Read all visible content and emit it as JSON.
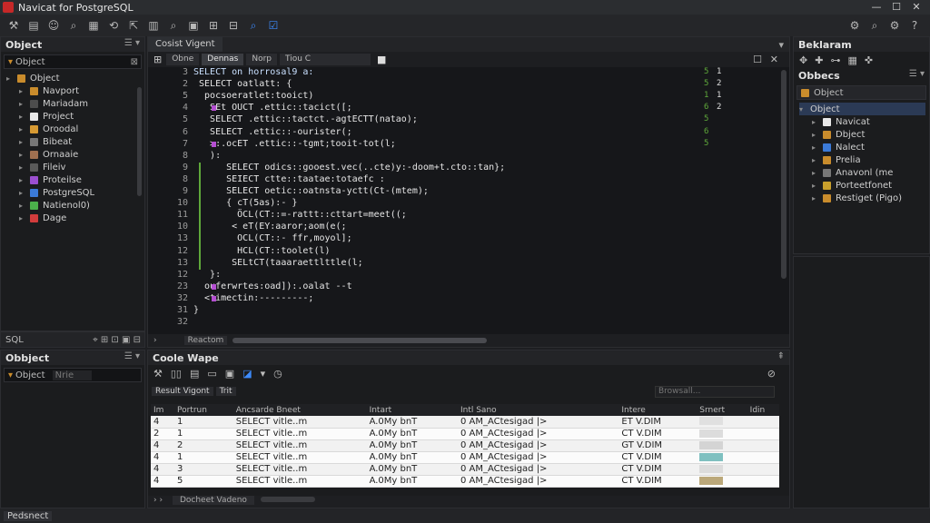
{
  "window": {
    "title": "Navicat for PostgreSQL"
  },
  "toolbar": {
    "icons": [
      "wrench-icon",
      "folder-icon",
      "user-icon",
      "search-icon",
      "grid-icon",
      "refresh-icon",
      "nav-icon",
      "chart-icon",
      "search-icon",
      "table-icon",
      "function-icon",
      "filter-icon",
      "query-icon",
      "check-icon"
    ]
  },
  "left_top": {
    "header": "Object",
    "search_value": "Object",
    "tree_header": "Object",
    "items": [
      {
        "label": "Navport",
        "color": "#c98c2c"
      },
      {
        "label": "Mariadam",
        "color": "#4d4d4d"
      },
      {
        "label": "Project",
        "color": "#e8e8e8"
      },
      {
        "label": "Oroodal",
        "color": "#d79a33"
      },
      {
        "label": "Bibeat",
        "color": "#777777"
      },
      {
        "label": "Ornaaie",
        "color": "#a07050"
      },
      {
        "label": "Fileiv",
        "color": "#5a5a5a"
      },
      {
        "label": "Proteilse",
        "color": "#9b4fd0"
      },
      {
        "label": "PostgreSQL",
        "color": "#3b7ad8"
      },
      {
        "label": "Natienol0)",
        "color": "#4bb04b"
      },
      {
        "label": "Dage",
        "color": "#d23c3c"
      }
    ],
    "footer_label": "SQL"
  },
  "left_bottom": {
    "header": "Obbject",
    "search_value": "Object",
    "placeholder": "Nrie"
  },
  "editor": {
    "tabs": [
      "Cosist Vigent"
    ],
    "subtabs": [
      "Obne",
      "Dennas",
      "Norp",
      "Tiou C"
    ],
    "line_numbers": [
      "3",
      "2",
      "5",
      "4",
      "5",
      "6",
      "7",
      "8",
      "9",
      "8",
      "9",
      "10",
      "11",
      "10",
      "13",
      "12",
      "13",
      "12",
      "23",
      "32",
      "31",
      "32"
    ],
    "lines": [
      "SELECT on horrosal9 a:",
      " SELECT oatlatt: {",
      "  pocsoeratlet:tooict)",
      "   SEt OUCT .ettic::tacict([;",
      "   SELECT .ettic::tactct.-agtECTT(natao);",
      "   SELECT .ettic::-ourister(;",
      "   >:.ocET .ettic::-tgmt;tooit-tot(l;",
      "   ):",
      "      SELECT odics::gooest.vec(..cte)y:-doom+t.cto::tan};",
      "      SEIECT ctte::taatae:totaefc :",
      "      SELECT oetic::oatnsta-yctt(Ct-(mtem);",
      "      { cT(5as):- }",
      "        ÖCL(CT::=-rattt::cttart=meet((;",
      "       < eT(EY:aaror;aom(e(;",
      "        OCL(CT::- ffr,moyol];",
      "        HCL(CT::toolet(l)",
      "       SELtCT(taaaraettlttle(l;",
      "   }:",
      "  ouferwrtes:oad]):.oalat --t",
      "  <timectin:---------;",
      "}",
      ""
    ],
    "right_marks": [
      "5",
      "5",
      "1",
      "6",
      "5",
      "6",
      "5"
    ],
    "right_marks2": [
      "1",
      "2",
      "1",
      "2"
    ],
    "status_tab": "Reactom"
  },
  "right_panel": {
    "header": "Beklaram",
    "sub_header": "Obbecs",
    "object_header": "Object",
    "object_sub": "Object",
    "items": [
      {
        "label": "Navicat",
        "color": "#e8e8e8"
      },
      {
        "label": "Dbject",
        "color": "#c98c2c"
      },
      {
        "label": "Nalect",
        "color": "#3b7ad8"
      },
      {
        "label": "Prelia",
        "color": "#c98c2c"
      },
      {
        "label": "Anavonl (me",
        "color": "#777777"
      },
      {
        "label": "Porteetfonet",
        "color": "#c9a02c"
      },
      {
        "label": "Restiget (Pigo)",
        "color": "#c98c2c"
      }
    ]
  },
  "result": {
    "header": "Coole Wape",
    "tabs": [
      "Result Vigont",
      "Trit"
    ],
    "filter_placeholder": "Browsall...",
    "columns": [
      "Im",
      "Portrun",
      "Ancsarde Bneet",
      "Intart",
      "Intl Sano",
      "Intere",
      "Srnert",
      "Idin"
    ],
    "rows": [
      {
        "id": "4",
        "n": "1",
        "sql": "SELECT vitle..m",
        "a": "A.0My bnT",
        "b": "0 AM_ACtesigad |>",
        "c": "ET V.DIM",
        "sw": "#e0e0e0"
      },
      {
        "id": "2",
        "n": "1",
        "sql": "SELECT vitle..m",
        "a": "A.0My bnT",
        "b": "0 AM_ACtesigad |>",
        "c": "CT V.DIM",
        "sw": "#dcdcdc"
      },
      {
        "id": "4",
        "n": "2",
        "sql": "SELECT vitle..m",
        "a": "A.0My bnT",
        "b": "0 AM_ACtesigad |>",
        "c": "GT V.DIM",
        "sw": "#d4d4d4"
      },
      {
        "id": "4",
        "n": "1",
        "sql": "SELECT vitle..m",
        "a": "A.0My bnT",
        "b": "0 AM_ACtesigad |>",
        "c": "CT V.DIM",
        "sw": "#7fc0c0"
      },
      {
        "id": "4",
        "n": "3",
        "sql": "SELECT vitle..m",
        "a": "A.0My bnT",
        "b": "0 AM_ACtesigad |>",
        "c": "CT V.DIM",
        "sw": "#dcdcdc"
      },
      {
        "id": "4",
        "n": "5",
        "sql": "SELECT vitle..m",
        "a": "A.0My bnT",
        "b": "0 AM_ACtesigad |>",
        "c": "CT V.DIM",
        "sw": "#bba87a"
      }
    ],
    "footer_label": "Docheet Vadeno"
  },
  "statusbar": {
    "label": "Pedsnect"
  }
}
